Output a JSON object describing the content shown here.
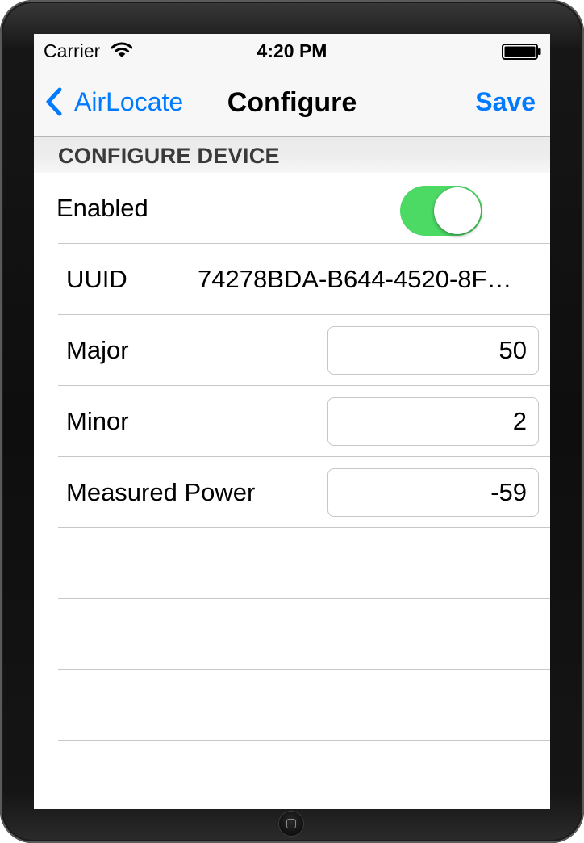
{
  "status_bar": {
    "carrier": "Carrier",
    "time": "4:20 PM",
    "wifi_icon": "wifi-icon",
    "battery_icon": "battery-full-icon"
  },
  "nav_bar": {
    "back_label": "AirLocate",
    "back_icon": "chevron-left-icon",
    "title": "Configure",
    "save_label": "Save"
  },
  "section": {
    "title": "CONFIGURE DEVICE"
  },
  "rows": {
    "enabled": {
      "label": "Enabled",
      "value": true
    },
    "uuid": {
      "label": "UUID",
      "value": "74278BDA-B644-4520-8F…"
    },
    "major": {
      "label": "Major",
      "value": "50"
    },
    "minor": {
      "label": "Minor",
      "value": "2"
    },
    "measured_power": {
      "label": "Measured Power",
      "value": "-59"
    }
  },
  "colors": {
    "accent": "#007aff",
    "toggle_on": "#4cd964",
    "separator": "#c8c7cc"
  }
}
